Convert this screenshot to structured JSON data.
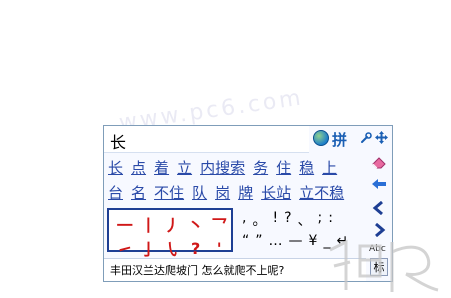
{
  "watermark": {
    "top_text": "www.pc6.com"
  },
  "composition": {
    "text": "长"
  },
  "mode": {
    "icon": "globe-icon",
    "label": "拼"
  },
  "candidates": {
    "row1": [
      "长",
      "点",
      "着",
      "立",
      "内搜索",
      "务",
      "住",
      "稳",
      "上"
    ],
    "row2": [
      "台",
      "名",
      "不住",
      "队",
      "岗",
      "牌",
      "长站",
      "立不稳"
    ]
  },
  "strokes": [
    "一",
    "丨",
    "丿",
    "丶",
    "乛",
    "㇀",
    "亅",
    "㇂",
    "?",
    "'"
  ],
  "punctuation": {
    "row1": [
      ",",
      "。",
      "!",
      "?",
      "、",
      ";",
      ":"
    ],
    "row2": [
      "“",
      "”",
      "…",
      "—",
      "¥",
      "_",
      "↵"
    ]
  },
  "hint": {
    "text": "丰田汉兰达爬坡门 怎么就爬不上呢?"
  },
  "tools": {
    "eraser_icon": "eraser-icon",
    "back_icon": "back-arrow-icon",
    "prev_icon": "prev-page-icon",
    "next_icon": "next-page-icon",
    "abc_label": "Abc",
    "biao_label": "标"
  },
  "colors": {
    "accent": "#1e3f94",
    "candidate": "#2a4aa8",
    "stroke": "#d01818"
  }
}
